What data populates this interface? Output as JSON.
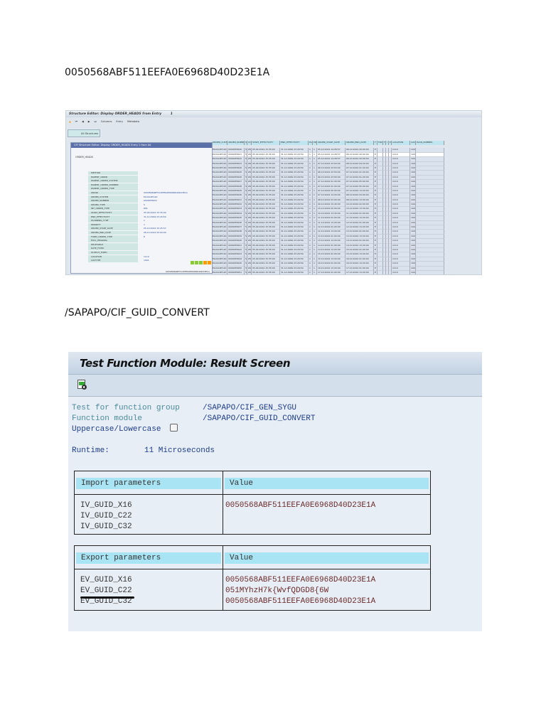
{
  "doc": {
    "guid_heading": "0050568ABF511EEFA0E6968D40D23E1A",
    "fm_heading": "/SAPAPO/CIF_GUID_CONVERT"
  },
  "structure_editor": {
    "title": "Structure Editor: Display ORDER_HEADS from Entry",
    "entry_no": "1",
    "toolbar": [
      "Columns",
      "Entry",
      "Metadata"
    ],
    "button": "All Structures",
    "popup_title": "CIF Structure Editor: Display ORDER_HEADS Entry 1 from 44",
    "root": "ORDER_HEADS",
    "fields": [
      {
        "name": "METHOD",
        "value": ""
      },
      {
        "name": "PARENT_ORDID",
        "value": ""
      },
      {
        "name": "PARENT_ORDER_SYSTEM",
        "value": ""
      },
      {
        "name": "PARENT_ORDER_NUMBER",
        "value": ""
      },
      {
        "name": "PARENT_ORDER_TYPE",
        "value": ""
      },
      {
        "name": "ORDID",
        "value": "0050568ABF511EEFA0E6968D40D23E1A"
      },
      {
        "name": "ORDER_SYSTEM",
        "value": "ELOCLNT120"
      },
      {
        "name": "ORDER_NUMBER",
        "value": "0000035621"
      },
      {
        "name": "ORDER_TYPE",
        "value": "5"
      },
      {
        "name": "INT_ORDER_TYPE",
        "value": "ZOL"
      },
      {
        "name": "START_EFFECTIVITY",
        "value": "05.09.2024 15:35:00"
      },
      {
        "name": "END_EFFECTIVITY",
        "value": "31.12.2999 23:29:59"
      },
      {
        "name": "PLANNING_TYPE",
        "value": "1"
      },
      {
        "name": "PRIORITY",
        "value": "1"
      },
      {
        "name": "ORDER_START_DATE",
        "value": "05.10.2024 15:25:57"
      },
      {
        "name": "ORDER_END_DATE",
        "value": "06.10.2024 20:00:00"
      },
      {
        "name": "FIXED_ORDER_TYPE",
        "value": "E"
      },
      {
        "name": "EXCL_PEGGING",
        "value": ""
      },
      {
        "name": "DELETABLE",
        "value": ""
      },
      {
        "name": "DATE_FIXED",
        "value": ""
      },
      {
        "name": "OUTPUT_FIXED",
        "value": ""
      },
      {
        "name": "LOCATION",
        "value": "1110"
      },
      {
        "name": "LOCTYPE",
        "value": "1001"
      }
    ],
    "columns": [
      "ORDER_CUST",
      "ORDER_NUMBER",
      "S",
      "UOM",
      "START_EFFECTIVITY",
      "END_EFFECTIVITY",
      "PLA",
      "PRI",
      "ORDER_START_DATE",
      "ORDER_END_DATE",
      "F",
      "FRXD",
      "F",
      "I",
      "E",
      "LOCATION",
      "LOCT",
      "PLAN_NUMBER"
    ],
    "rows": [
      [
        "ELOCLNT120",
        "0000035620",
        "5",
        "ZOL",
        "05.09.2024 15:35:00",
        "31.12.2999 23:29:59",
        "1",
        "1",
        "05.10.2024 14:28:57",
        "06.10.2024 20:00:00",
        "E",
        "",
        "",
        "",
        "",
        "1110",
        "1001",
        ""
      ],
      [
        "ELOCLNT120",
        "0000035621",
        "5",
        "ZOL",
        "05.09.2024 15:35:00",
        "31.12.2999 23:29:59",
        "1",
        "1",
        "05.10.2024 14:28:57",
        "06.10.2024 20:00:00",
        "E",
        "",
        "",
        "",
        "",
        "1110",
        "1001",
        ""
      ],
      [
        "ELOCLNT120",
        "0000035622",
        "5",
        "ZOL",
        "05.09.2024 15:35:00",
        "31.12.2999 23:29:59",
        "1",
        "1",
        "05.10.2024 14:28:57",
        "06.10.2024 20:00:00",
        "E",
        "",
        "",
        "",
        "",
        "1110",
        "1001",
        ""
      ],
      [
        "ELOCLNT120",
        "0000035623",
        "5",
        "ZOL",
        "05.09.2024 15:35:00",
        "31.12.2999 23:29:59",
        "1",
        "1",
        "07.10.2024 23:50:00",
        "08.10.2024 04:20:00",
        "E",
        "",
        "",
        "",
        "",
        "1110",
        "1001",
        ""
      ],
      [
        "ELOCLNT120",
        "0000035626",
        "5",
        "ZOL",
        "05.09.2024 15:35:00",
        "31.12.2999 23:29:59",
        "1",
        "1",
        "06.10.2024 23:50:00",
        "07.10.2024 01:20:00",
        "E",
        "",
        "",
        "",
        "",
        "1110",
        "1001",
        ""
      ],
      [
        "ELOCLNT120",
        "0000035625",
        "5",
        "ZOL",
        "05.09.2024 15:35:00",
        "31.12.2999 23:29:59",
        "1",
        "1",
        "06.10.2024 23:50:00",
        "07.10.2024 01:20:00",
        "E",
        "",
        "",
        "",
        "",
        "1110",
        "1001",
        ""
      ],
      [
        "ELOCLNT120",
        "0000035626",
        "5",
        "ZOL",
        "05.09.2024 15:35:00",
        "31.12.2999 23:29:59",
        "1",
        "1",
        "06.10.2024 23:50:00",
        "07.10.2024 01:20:00",
        "E",
        "",
        "",
        "",
        "",
        "1110",
        "1001",
        ""
      ],
      [
        "ELOCLNT120",
        "0000035627",
        "5",
        "ZOL",
        "05.09.2024 15:35:00",
        "31.12.2999 23:29:59",
        "1",
        "1",
        "07.10.2024 01:20:00",
        "07.10.2024 05:00:00",
        "E",
        "",
        "",
        "",
        "",
        "1110",
        "1001",
        ""
      ],
      [
        "ELOCLNT120",
        "0000035628",
        "5",
        "ZOL",
        "05.09.2024 15:35:00",
        "31.12.2999 23:29:59",
        "1",
        "1",
        "07.10.2024 01:20:00",
        "07.10.2024 05:00:00",
        "E",
        "",
        "",
        "",
        "",
        "1110",
        "1001",
        ""
      ],
      [
        "ELOCLNT120",
        "0000035629",
        "5",
        "ZOL",
        "05.09.2024 15:35:00",
        "31.12.2999 23:29:59",
        "1",
        "1",
        "07.10.2024 05:00:00",
        "07.10.2024 13:20:00",
        "E",
        "",
        "",
        "",
        "",
        "1110",
        "1001",
        ""
      ],
      [
        "ELOCLNT120",
        "0000035630",
        "5",
        "ZOL",
        "05.09.2024 15:35:00",
        "31.12.2999 23:29:59",
        "1",
        "1",
        "07.10.2024 13:20:00",
        "08.10.2024 03:00:00",
        "E",
        "",
        "",
        "",
        "",
        "1110",
        "1001",
        ""
      ],
      [
        "ELOCLNT120",
        "0000035631",
        "5",
        "ZOL",
        "05.09.2024 15:35:00",
        "31.12.2999 23:29:59",
        "1",
        "1",
        "08.10.2024 03:00:00",
        "08.10.2024 13:00:00",
        "E",
        "",
        "",
        "",
        "",
        "1110",
        "1001",
        ""
      ],
      [
        "ELOCLNT120",
        "0000035632",
        "5",
        "ZOL",
        "05.09.2024 15:35:00",
        "31.12.2999 23:29:59",
        "1",
        "1",
        "09.10.2024 15:40:00",
        "10.10.2024 02:00:00",
        "E",
        "",
        "",
        "",
        "",
        "1110",
        "1001",
        ""
      ],
      [
        "ELOCLNT120",
        "0000035633",
        "5",
        "ZOL",
        "05.09.2024 15:35:00",
        "31.12.2999 23:29:59",
        "1",
        "1",
        "10.10.2024 02:00:00",
        "10.10.2024 13:30:00",
        "E",
        "",
        "",
        "",
        "",
        "1110",
        "1001",
        ""
      ],
      [
        "ELOCLNT120",
        "0000035634",
        "5",
        "ZOL",
        "05.09.2024 15:35:00",
        "31.12.2999 23:29:59",
        "1",
        "1",
        "10.10.2024 13:30:00",
        "11.10.2024 01:00:00",
        "E",
        "",
        "",
        "",
        "",
        "1110",
        "1001",
        ""
      ],
      [
        "ELOCLNT120",
        "0000035635",
        "5",
        "ZOL",
        "05.09.2024 15:35:00",
        "31.12.2999 23:29:59",
        "1",
        "1",
        "11.10.2024 01:00:00",
        "11.10.2024 13:20:00",
        "E",
        "",
        "",
        "",
        "",
        "1110",
        "1001",
        ""
      ],
      [
        "ELOCLNT120",
        "0000035636",
        "5",
        "ZOL",
        "05.09.2024 15:35:00",
        "31.12.2999 23:29:59",
        "1",
        "1",
        "11.10.2024 13:20:00",
        "12.10.2024 01:00:00",
        "E",
        "",
        "",
        "",
        "",
        "1110",
        "1001",
        ""
      ],
      [
        "ELOCLNT120",
        "0000035637",
        "5",
        "ZOL",
        "05.09.2024 15:35:00",
        "31.12.2999 23:29:59",
        "1",
        "1",
        "12.10.2024 01:00:00",
        "12.10.2024 13:20:00",
        "E",
        "",
        "",
        "",
        "",
        "1110",
        "1001",
        ""
      ],
      [
        "ELOCLNT120",
        "0000035638",
        "5",
        "ZOL",
        "05.09.2024 15:35:00",
        "31.12.2999 23:29:59",
        "1",
        "1",
        "12.10.2024 13:20:00",
        "13.10.2024 01:00:00",
        "E",
        "",
        "",
        "",
        "",
        "1110",
        "1001",
        ""
      ],
      [
        "ELOCLNT120",
        "0000035639",
        "5",
        "ZOL",
        "05.09.2024 15:35:00",
        "31.12.2999 23:29:59",
        "1",
        "1",
        "13.10.2024 01:00:00",
        "13.10.2024 13:20:00",
        "E",
        "",
        "",
        "",
        "",
        "1110",
        "1001",
        ""
      ],
      [
        "ELOCLNT120",
        "0000035640",
        "5",
        "ZOL",
        "05.09.2024 15:35:00",
        "31.12.2999 23:29:59",
        "1",
        "1",
        "13.10.2024 13:20:00",
        "14.10.2024 01:00:00",
        "E",
        "",
        "",
        "",
        "",
        "1110",
        "1001",
        ""
      ],
      [
        "ELOCLNT120",
        "0000035641",
        "5",
        "ZOL",
        "05.09.2024 15:35:00",
        "31.12.2999 23:29:59",
        "1",
        "1",
        "14.10.2024 01:00:00",
        "14.10.2024 13:20:00",
        "E",
        "",
        "",
        "",
        "",
        "1110",
        "1001",
        ""
      ],
      [
        "ELOCLNT120",
        "0000035642",
        "5",
        "ZOL",
        "05.09.2024 15:35:00",
        "31.12.2999 23:29:59",
        "1",
        "1",
        "14.10.2024 13:20:00",
        "15.10.2024 01:00:00",
        "E",
        "",
        "",
        "",
        "",
        "1110",
        "1001",
        ""
      ],
      [
        "ELOCLNT120",
        "0000035643",
        "5",
        "ZOL",
        "05.09.2024 15:35:00",
        "31.12.2999 23:29:59",
        "1",
        "1",
        "15.10.2024 01:00:00",
        "15.10.2024 13:20:00",
        "E",
        "",
        "",
        "",
        "",
        "1110",
        "1001",
        ""
      ],
      [
        "ELOCLNT120",
        "0000035644",
        "5",
        "ZOL",
        "05.09.2024 15:35:00",
        "31.12.2999 23:29:59",
        "1",
        "1",
        "15.10.2024 13:20:00",
        "16.10.2024 01:00:00",
        "E",
        "",
        "",
        "",
        "",
        "1110",
        "1001",
        ""
      ],
      [
        "ELOCLNT120",
        "0000035645",
        "5",
        "ZOL",
        "05.09.2024 15:35:00",
        "31.12.2999 23:29:59",
        "1",
        "1",
        "16.10.2024 01:00:00",
        "16.10.2024 13:20:00",
        "E",
        "",
        "",
        "",
        "",
        "1110",
        "1001",
        ""
      ],
      [
        "ELOCLNT120",
        "0000035650",
        "5",
        "ZOL",
        "05.09.2024 15:35:00",
        "31.12.2999 23:29:59",
        "1",
        "1",
        "16.10.2024 13:20:00",
        "17.10.2024 01:00:00",
        "E",
        "",
        "",
        "",
        "",
        "1110",
        "1001",
        ""
      ],
      [
        "ELOCLNT120",
        "0000035651",
        "5",
        "ZOL",
        "05.09.2024 15:35:00",
        "31.12.2999 23:29:59",
        "1",
        "1",
        "17.10.2024 01:00:00",
        "17.10.2024 13:20:00",
        "E",
        "",
        "",
        "",
        "",
        "1110",
        "1001",
        ""
      ],
      [
        "ELOCLNT120",
        "0000035652",
        "5",
        "ZOL",
        "05.09.2024 15:35:00",
        "31.12.2999 23:29:59",
        "1",
        "1",
        "17.10.2024 13:20:00",
        "18.10.2024 01:00:00",
        "E",
        "",
        "",
        "",
        "",
        "1110",
        "1001",
        ""
      ]
    ],
    "bottom_value": "0050568ABF511EEFA0E6968D40D23E1A"
  },
  "result_screen": {
    "title": "Test Function Module: Result Screen",
    "test_group_label": "Test for function group",
    "test_group_value": "/SAPAPO/CIF_GEN_SYGU",
    "fm_label": "Function module",
    "fm_value": "/SAPAPO/CIF_GUID_CONVERT",
    "case_label": "Uppercase/Lowercase",
    "runtime_label": "Runtime:",
    "runtime_value": "11 Microseconds",
    "import": {
      "header": "Import parameters",
      "value_header": "Value",
      "params": [
        "IV_GUID_X16",
        "IV_GUID_C22",
        "IV_GUID_C32"
      ],
      "values": [
        "0050568ABF511EEFA0E6968D40D23E1A",
        "",
        ""
      ]
    },
    "export": {
      "header": "Export parameters",
      "value_header": "Value",
      "params": [
        "EV_GUID_X16",
        "EV_GUID_C22",
        "EV_GUID_C32"
      ],
      "values": [
        "0050568ABF511EEFA0E6968D40D23E1A",
        "051MYhzH7k{WvfQDGD8{6W",
        "0050568ABF511EEFA0E6968D40D23E1A"
      ]
    }
  }
}
